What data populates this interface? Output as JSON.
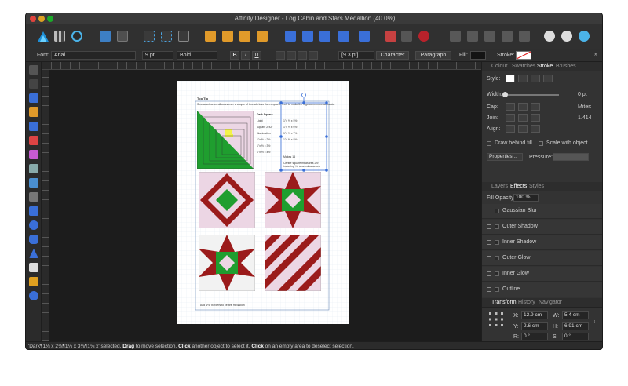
{
  "window": {
    "title": "Affinity Designer - Log Cabin and Stars Medallion (40.0%)"
  },
  "context_bar": {
    "font_label": "Font:",
    "font_value": "Arial",
    "size_value": "9 pt",
    "weight_value": "Bold",
    "bold": "B",
    "italic": "I",
    "underline": "U",
    "spacing_value": "[9.3 pt]",
    "character_button": "Character",
    "paragraph_button": "Paragraph",
    "fill_label": "Fill:",
    "stroke_label": "Stroke:"
  },
  "stroke_panel": {
    "tabs": [
      "Colour",
      "Swatches",
      "Stroke",
      "Brushes"
    ],
    "active_tab": "Stroke",
    "style_label": "Style:",
    "width_label": "Width:",
    "width_value": "0 pt",
    "cap_label": "Cap:",
    "join_label": "Join:",
    "miter_label": "Miter:",
    "miter_value": "1.414",
    "align_label": "Align:",
    "draw_behind_fill": "Draw behind fill",
    "scale_with_object": "Scale with object",
    "properties_button": "Properties...",
    "pressure_label": "Pressure:"
  },
  "effects_panel": {
    "tabs": [
      "Layers",
      "Effects",
      "Styles"
    ],
    "active_tab": "Effects",
    "fill_opacity_label": "Fill Opacity:",
    "fill_opacity_value": "100 %",
    "effects": [
      "Gaussian Blur",
      "Outer Shadow",
      "Inner Shadow",
      "Outer Glow",
      "Inner Glow",
      "Outline"
    ]
  },
  "transform_panel": {
    "tabs": [
      "Transform",
      "History",
      "Navigator"
    ],
    "active_tab": "Transform",
    "x_label": "X:",
    "x_value": "12.9 cm",
    "y_label": "Y:",
    "y_value": "2.6 cm",
    "w_label": "W:",
    "w_value": "5.4 cm",
    "h_label": "H:",
    "h_value": "6.91 cm",
    "r_label": "R:",
    "r_value": "0 °",
    "s_label": "S:",
    "s_value": "0 °"
  },
  "document": {
    "heading": "Top Tip",
    "intro": "Sew scant seam allowances – a couple of threads less than a quarter inch to make the logs come more accurate.",
    "cutting_title": "Dark Square",
    "cutting_lines": [
      "Light",
      "Square 2\"x2\"",
      "Illumination",
      "1\"x ½ x 2½",
      "1\"x ½ x 3½",
      "1\"x ½ x 4½",
      "1\"x ½ x 5½",
      "1\"x ½ x 6½",
      "1\"x ½ x 7½",
      "1\"x ½ x 8½"
    ],
    "cutting_notes": [
      "Makes 16",
      "Centre square measures 2½\" including ¼\" seam allowances"
    ],
    "footer": "Add 1½\" borders to centre medallion"
  },
  "status": {
    "prefix": "'Dark¶1⅛ x 2⅛¶1⅛ x 3⅛¶1⅛ x' selected. ",
    "drag": "Drag",
    "mid1": " to move selection. ",
    "click1": "Click",
    "mid2": " another object to select it. ",
    "click2": "Click",
    "suffix": " on an empty area to deselect selection."
  },
  "colors": {
    "accent_red": "#9b1b1b",
    "accent_green": "#1f9e2f",
    "light_pink": "#ecd6e4",
    "selection_blue": "#3a6fd8"
  }
}
